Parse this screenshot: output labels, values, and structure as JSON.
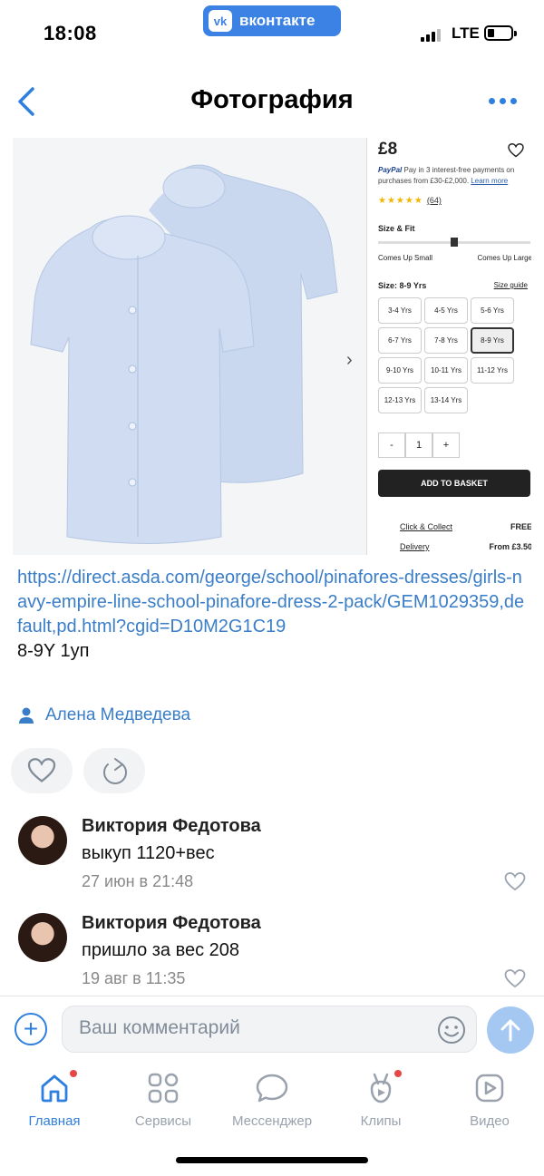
{
  "status_bar": {
    "time": "18:08",
    "app_pill": "вконтакте",
    "vk_logo": "vk",
    "network": "LTE"
  },
  "nav": {
    "title": "Фотография"
  },
  "photo": {
    "price": "£8",
    "paypal_brand": "PayPal",
    "paypal_text": "Pay in 3 interest-free payments on purchases from £30-£2,000.",
    "paypal_link": "Learn more",
    "rating_stars": "★★★★★",
    "rating_count": "(64)",
    "size_fit_label": "Size & Fit",
    "fit_left": "Comes Up Small",
    "fit_right": "Comes Up Large",
    "size_label": "Size: 8-9 Yrs",
    "size_guide": "Size guide",
    "sizes": [
      "3-4 Yrs",
      "4-5 Yrs",
      "5-6 Yrs",
      "6-7 Yrs",
      "7-8 Yrs",
      "8-9 Yrs",
      "9-10 Yrs",
      "10-11 Yrs",
      "11-12 Yrs",
      "12-13 Yrs",
      "13-14 Yrs"
    ],
    "selected_size": "8-9 Yrs",
    "qty_minus": "-",
    "qty_value": "1",
    "qty_plus": "+",
    "add_to_basket": "ADD TO BASKET",
    "click_collect": "Click & Collect",
    "click_collect_price": "FREE",
    "delivery": "Delivery",
    "delivery_price": "From £3.50"
  },
  "caption": {
    "link": "https://direct.asda.com/george/school/pinafores-dresses/girls-navy-empire-line-school-pinafore-dress-2-pack/GEM1029359,default,pd.html?cgid=D10M2G1C19",
    "note": "8-9Y 1уп"
  },
  "author": {
    "name": "Алена Медведева"
  },
  "comments": [
    {
      "name": "Виктория Федотова",
      "text": "выкуп 1120+вес",
      "time": "27 июн в 21:48"
    },
    {
      "name": "Виктория Федотова",
      "text": "пришло за вес 208",
      "time": "19 авг в 11:35"
    }
  ],
  "composer": {
    "placeholder": "Ваш комментарий"
  },
  "tabs": [
    {
      "label": "Главная",
      "icon": "home-icon"
    },
    {
      "label": "Сервисы",
      "icon": "grid-icon"
    },
    {
      "label": "Мессенджер",
      "icon": "chat-icon"
    },
    {
      "label": "Клипы",
      "icon": "clips-icon"
    },
    {
      "label": "Видео",
      "icon": "video-icon"
    }
  ],
  "colors": {
    "accent": "#2f7fe0",
    "link": "#3a7ec8",
    "notification": "#e64646"
  }
}
